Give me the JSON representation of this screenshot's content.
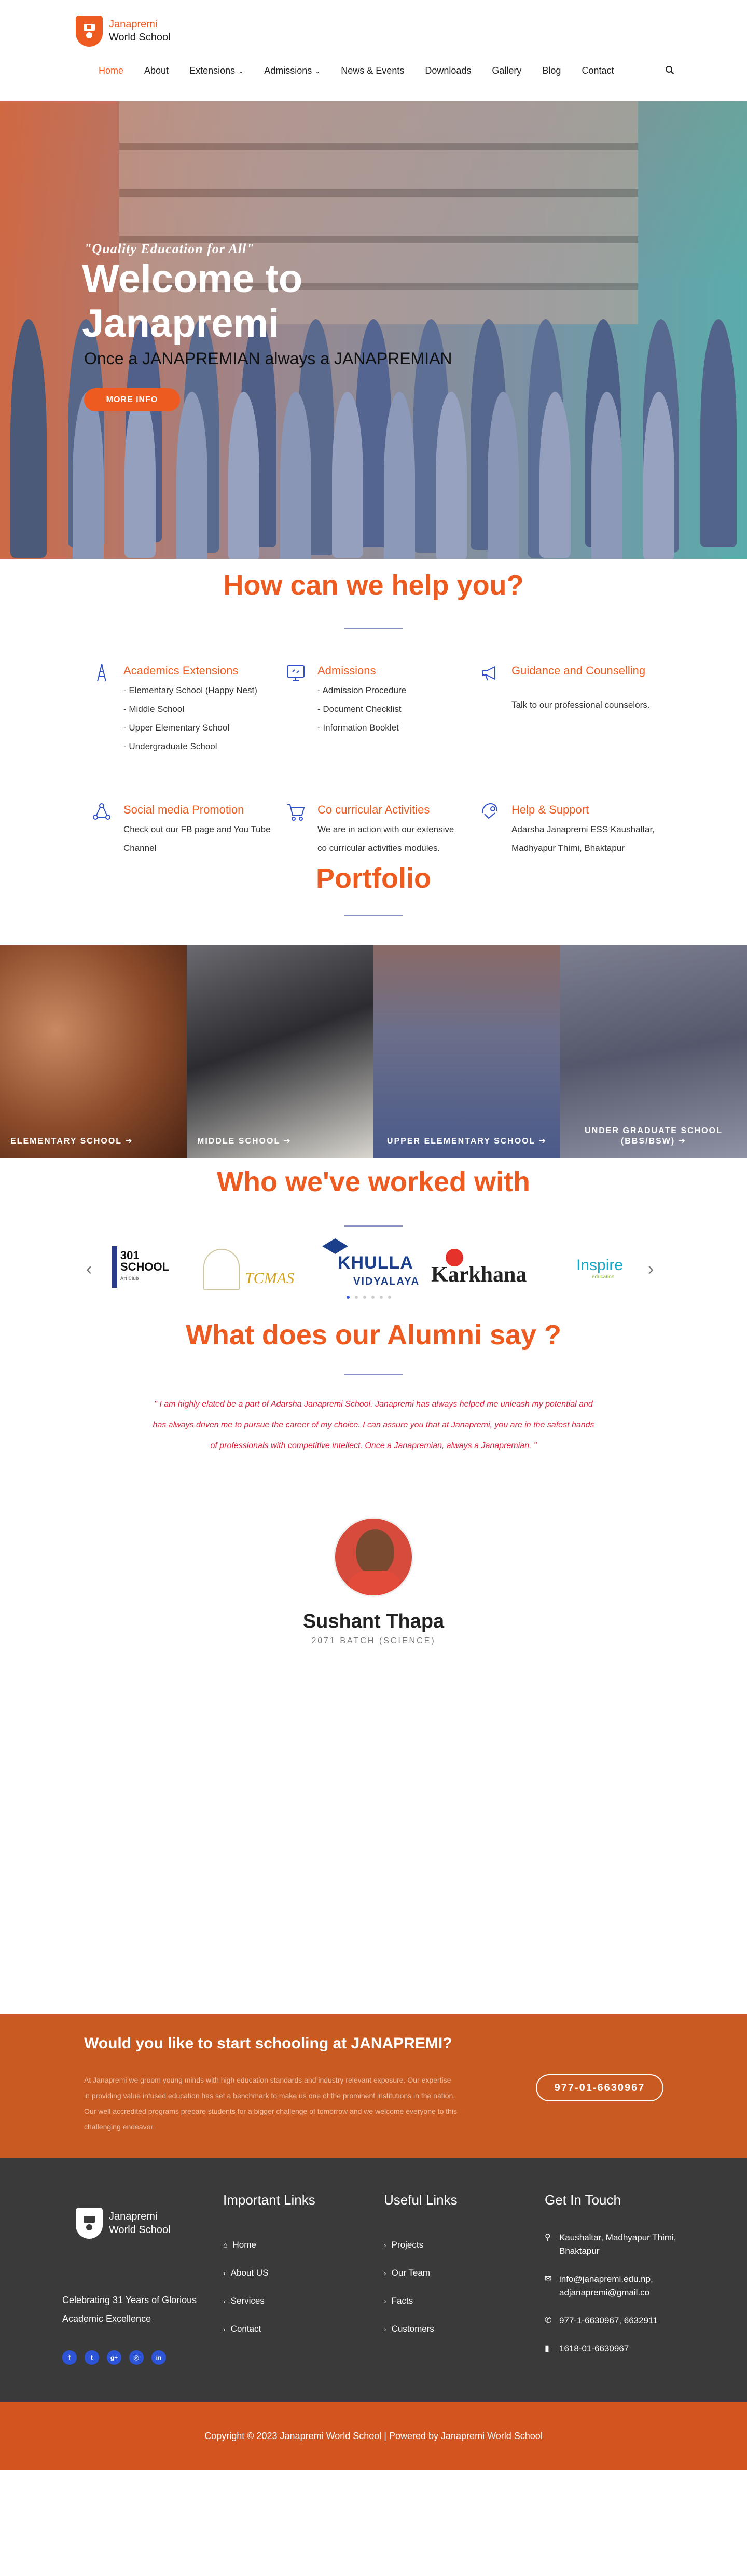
{
  "brand": {
    "line1": "Janapremi",
    "line2": "World School",
    "color": "#ee5b20"
  },
  "nav": {
    "items": [
      {
        "label": "Home",
        "active": true
      },
      {
        "label": "About",
        "caret": false
      },
      {
        "label": "Extensions",
        "caret": true
      },
      {
        "label": "Admissions",
        "caret": true
      },
      {
        "label": "News & Events"
      },
      {
        "label": "Downloads"
      },
      {
        "label": "Gallery"
      },
      {
        "label": "Blog"
      },
      {
        "label": "Contact"
      }
    ],
    "search_icon": "search-icon"
  },
  "hero": {
    "quote": "\"Quality Education for All\"",
    "title": "Welcome to Janapremi",
    "subtitle": "Once a JANAPREMIAN always a JANAPREMIAN",
    "button": "MORE INFO"
  },
  "help": {
    "title": "How can we help you?",
    "items": [
      {
        "heading": "Academics Extensions",
        "icon": "tower-icon",
        "text": "- Elementary School (Happy Nest)\n- Middle School\n- Upper Elementary School\n- Undergraduate School"
      },
      {
        "heading": "Admissions",
        "icon": "monitor-icon",
        "text": "- Admission Procedure\n- Document Checklist\n- Information Booklet"
      },
      {
        "heading": "Guidance and Counselling",
        "icon": "megaphone-icon",
        "text": "Talk to our professional counselors."
      },
      {
        "heading": "Social media Promotion",
        "icon": "share-icon",
        "text": "Check out our FB page and You Tube Channel"
      },
      {
        "heading": "Co curricular Activities",
        "icon": "cart-icon",
        "text": "We are in action with our extensive\nco curricular activities modules."
      },
      {
        "heading": "Help & Support",
        "icon": "support-icon",
        "text": "Adarsha  Janapremi ESS Kaushaltar, Madhyapur Thimi, Bhaktapur"
      }
    ]
  },
  "portfolio": {
    "title": "Portfolio",
    "items": [
      {
        "label": "ELEMENTARY SCHOOL",
        "color": "#8a4a2a"
      },
      {
        "label": "MIDDLE SCHOOL",
        "color": "#2b2b30"
      },
      {
        "label": "UPPER ELEMENTARY SCHOOL",
        "color": "#5a5a78"
      },
      {
        "label": "UNDER GRADUATE SCHOOL (BBS/BSW)",
        "color": "#6b6e80"
      }
    ]
  },
  "partners": {
    "title": "Who we've worked with",
    "logos": [
      {
        "name": "301 SCHOOL",
        "sub": "Art Club"
      },
      {
        "name": "TCMAS",
        "sub": ""
      },
      {
        "name": "KHULLA",
        "sub": "VIDYALAYA"
      },
      {
        "name": "Karkhana",
        "sub": ""
      },
      {
        "name": "Inspire",
        "sub": "education"
      }
    ]
  },
  "alumni": {
    "title": "What does our Alumni say ?",
    "quote": "\" I am highly elated be a part of Adarsha Janapremi School. Janapremi has always helped me unleash my potential and has always driven me to pursue the career of my choice. I can assure you that at Janapremi, you are in the safest hands of professionals with competitive intellect. Once a Janapremian, always a Janapremian. \"",
    "name": "Sushant Thapa",
    "batch": "2071 BATCH (SCIENCE)"
  },
  "cta": {
    "heading": "Would you like to start schooling at JANAPREMI?",
    "text": "At Janapremi we groom young minds with high education standards and industry relevant exposure. Our expertise in providing value infused education has set a benchmark to make us one of the prominent institutions in the nation. Our well accredited programs prepare students for a bigger challenge of tomorrow and we welcome everyone to this challenging endeavor.",
    "phone": "977-01-6630967"
  },
  "footer": {
    "brand": {
      "line1": "Janapremi",
      "line2": "World School"
    },
    "tagline": "Celebrating 31 Years of Glorious Academic Excellence",
    "important_links": {
      "title": "Important Links",
      "items": [
        "Home",
        "About US",
        "Services",
        "Contact"
      ]
    },
    "useful_links": {
      "title": "Useful Links",
      "items": [
        "Projects",
        "Our Team",
        "Facts",
        "Customers"
      ]
    },
    "contact": {
      "title": "Get In Touch",
      "address": "Kaushaltar, Madhyapur Thimi, Bhaktapur",
      "email": "info@janapremi.edu.np, adjanapremi@gmail.co",
      "phone": "977-1-6630967, 6632911",
      "fax": "1618-01-6630967"
    },
    "social_icons": [
      "facebook-icon",
      "twitter-icon",
      "google-plus-icon",
      "instagram-icon",
      "linkedin-icon"
    ],
    "copyright": "Copyright © 2023 Janapremi World School | Powered by Janapremi World School"
  }
}
